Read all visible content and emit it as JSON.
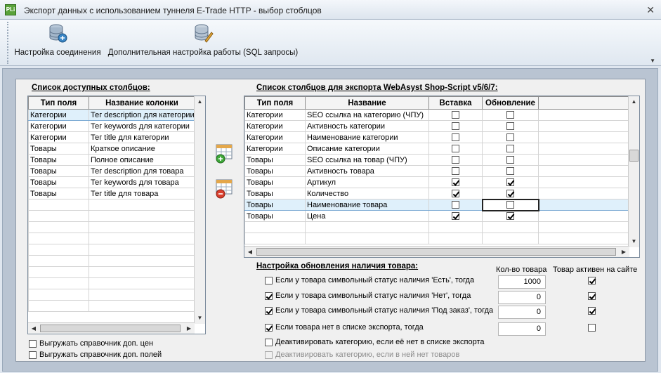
{
  "window": {
    "icon_text": "PLi",
    "title": "Экспорт данных с использованием туннеля E-Trade HTTP - выбор стоблцов",
    "close": "✕"
  },
  "toolbar": {
    "connection_label": "Настройка соединения",
    "advanced_label": "Дополнительная настройка работы (SQL запросы)"
  },
  "available": {
    "title": "Список доступных столбцов:",
    "col_type": "Тип поля",
    "col_name": "Название колонки",
    "rows": [
      {
        "type": "Категории",
        "name": "Тег description для категории"
      },
      {
        "type": "Категории",
        "name": "Тег keywords для категории"
      },
      {
        "type": "Категории",
        "name": "Тег title для категории"
      },
      {
        "type": "Товары",
        "name": "Краткое описание"
      },
      {
        "type": "Товары",
        "name": "Полное описание"
      },
      {
        "type": "Товары",
        "name": "Тег description для товара"
      },
      {
        "type": "Товары",
        "name": "Тег keywords для товара"
      },
      {
        "type": "Товары",
        "name": "Тег title для товара"
      },
      {
        "type": "",
        "name": ""
      },
      {
        "type": "",
        "name": ""
      },
      {
        "type": "",
        "name": ""
      },
      {
        "type": "",
        "name": ""
      },
      {
        "type": "",
        "name": ""
      },
      {
        "type": "",
        "name": ""
      },
      {
        "type": "",
        "name": ""
      },
      {
        "type": "",
        "name": ""
      },
      {
        "type": "",
        "name": ""
      },
      {
        "type": "",
        "name": ""
      }
    ]
  },
  "export": {
    "title": "Список столбцов для экспорта WebAsyst Shop-Script v5/6/7:",
    "col_type": "Тип поля",
    "col_name": "Название",
    "col_insert": "Вставка",
    "col_update": "Обновление",
    "rows": [
      {
        "type": "Категории",
        "name": "SEO ссылка на категорию (ЧПУ)",
        "insert": false,
        "update": false
      },
      {
        "type": "Категории",
        "name": "Активность категории",
        "insert": false,
        "update": false
      },
      {
        "type": "Категории",
        "name": "Наименование категории",
        "insert": false,
        "update": false
      },
      {
        "type": "Категории",
        "name": "Описание категории",
        "insert": false,
        "update": false
      },
      {
        "type": "Товары",
        "name": "SEO ссылка на товар (ЧПУ)",
        "insert": false,
        "update": false
      },
      {
        "type": "Товары",
        "name": "Активность товара",
        "insert": false,
        "update": false
      },
      {
        "type": "Товары",
        "name": "Артикул",
        "insert": true,
        "update": true
      },
      {
        "type": "Товары",
        "name": "Количество",
        "insert": true,
        "update": true
      },
      {
        "type": "Товары",
        "name": "Наименование товара",
        "insert": false,
        "update": false,
        "selected": true
      },
      {
        "type": "Товары",
        "name": "Цена",
        "insert": true,
        "update": true
      },
      {
        "type": "",
        "name": "",
        "blank": true
      },
      {
        "type": "",
        "name": "",
        "blank": true
      }
    ]
  },
  "stock": {
    "title": "Настройка обновления наличия товара:",
    "qty_header": "Кол-во товара",
    "active_header": "Товар активен на сайте",
    "rows": [
      {
        "label": "Если у товара символьный статус наличия 'Есть', тогда",
        "checked": false,
        "qty": "1000",
        "active": true
      },
      {
        "label": "Если у товара символьный статус наличия 'Нет', тогда",
        "checked": true,
        "qty": "0",
        "active": true
      },
      {
        "label": "Если у товара символьный статус наличия 'Под заказ', тогда",
        "checked": true,
        "qty": "0",
        "active": true
      },
      {
        "label": "Если товара нет в списке экспорта, тогда",
        "checked": true,
        "qty": "0",
        "active": false
      }
    ],
    "deactivate_not_in_list": "Деактивировать категорию, если её нет в списке экспорта",
    "deactivate_no_products": "Деактивировать категорию, если в ней нет товаров"
  },
  "options": {
    "export_prices": "Выгружать справочник доп. цен",
    "export_fields": "Выгружать справочник доп. полей"
  }
}
